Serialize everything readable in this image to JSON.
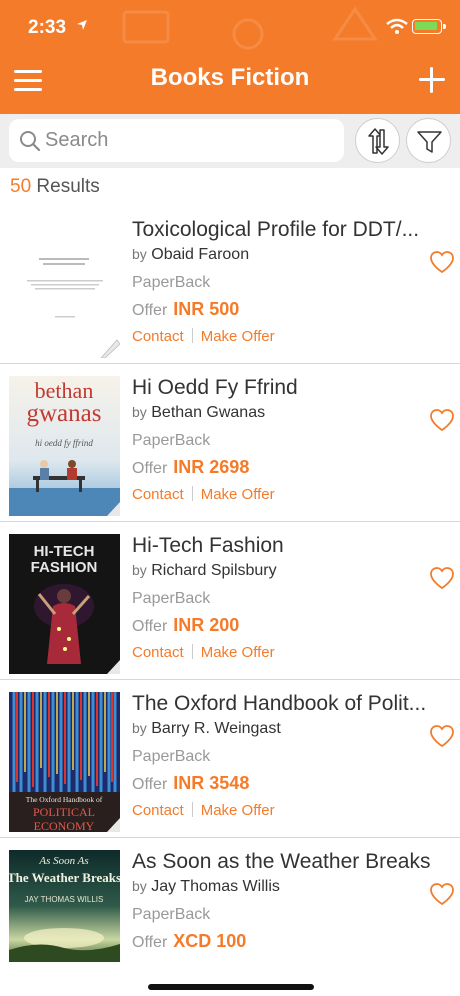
{
  "status_bar": {
    "time": "2:33"
  },
  "header": {
    "title": "Books Fiction",
    "menu_icon": "hamburger-icon",
    "add_icon": "plus-icon"
  },
  "search": {
    "placeholder": "Search",
    "value": ""
  },
  "results": {
    "count": "50",
    "label": "Results"
  },
  "labels": {
    "by": "by",
    "offer": "Offer",
    "contact": "Contact",
    "make_offer": "Make Offer"
  },
  "colors": {
    "accent": "#f47b2a",
    "background": "#ffffff",
    "search_row": "#eeeeee"
  },
  "books": [
    {
      "title": "Toxicological Profile for DDT/...",
      "author": "Obaid Faroon",
      "format": "PaperBack",
      "price": "INR 500",
      "show_actions": true
    },
    {
      "title": "Hi Oedd Fy Ffrind",
      "author": "Bethan Gwanas",
      "format": "PaperBack",
      "price": "INR 2698",
      "show_actions": true
    },
    {
      "title": "Hi-Tech Fashion",
      "author": "Richard Spilsbury",
      "format": "PaperBack",
      "price": "INR 200",
      "show_actions": true
    },
    {
      "title": "The Oxford Handbook of Polit...",
      "author": "Barry R. Weingast",
      "format": "PaperBack",
      "price": "INR 3548",
      "show_actions": true
    },
    {
      "title": "As Soon as the Weather Breaks",
      "author": "Jay Thomas Willis",
      "format": "PaperBack",
      "price": "XCD 100",
      "show_actions": false
    }
  ],
  "covers": {
    "cover2": {
      "line1": "bethan",
      "line2": "gwanas",
      "line3": "hi oedd fy ffrind"
    },
    "cover3": {
      "line1": "HI-TECH",
      "line2": "FASHION"
    },
    "cover4": {
      "line1": "The Oxford Handbook of",
      "line2": "POLITICAL",
      "line3": "ECONOMY"
    },
    "cover5": {
      "line1": "As Soon As",
      "line2": "The Weather Breaks",
      "line3": "JAY THOMAS WILLIS"
    }
  }
}
